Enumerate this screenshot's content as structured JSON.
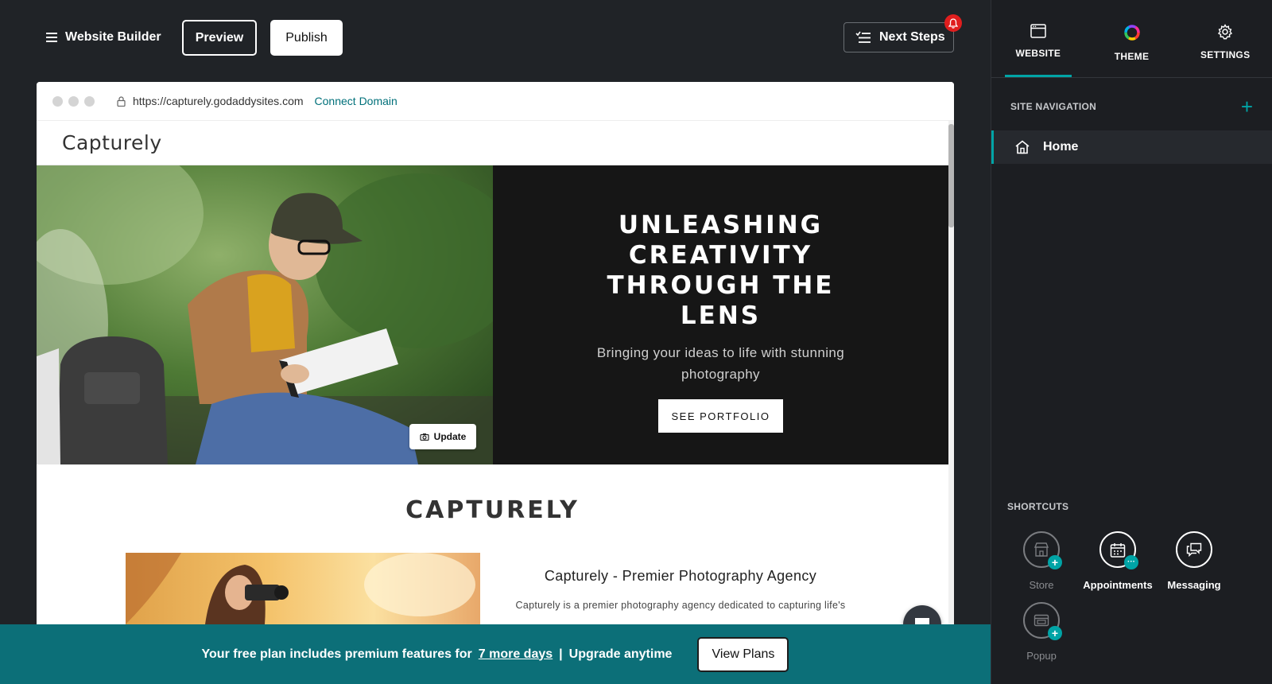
{
  "app": {
    "title": "Website Builder",
    "preview_label": "Preview",
    "publish_label": "Publish",
    "next_steps_label": "Next Steps"
  },
  "browser": {
    "url": "https://capturely.godaddysites.com",
    "connect_domain_label": "Connect Domain"
  },
  "site": {
    "logo": "Capturely",
    "hero": {
      "title": "UNLEASHING CREATIVITY THROUGH THE LENS",
      "subtitle": "Bringing your ideas to life with stunning photography",
      "cta_label": "SEE PORTFOLIO",
      "update_label": "Update"
    },
    "section_title": "CAPTURELY",
    "about": {
      "heading": "Capturely - Premier Photography Agency",
      "body": "Capturely is a premier photography agency dedicated to capturing life's"
    }
  },
  "banner": {
    "text_before": "Your free plan includes premium features for",
    "link_text": "7 more days",
    "separator": "|",
    "text_after": "Upgrade anytime",
    "button_label": "View Plans"
  },
  "panel": {
    "tabs": [
      {
        "label": "WEBSITE",
        "icon": "browser-window-icon",
        "active": true
      },
      {
        "label": "THEME",
        "icon": "color-wheel-icon",
        "active": false
      },
      {
        "label": "SETTINGS",
        "icon": "gear-icon",
        "active": false
      }
    ],
    "site_navigation_label": "SITE NAVIGATION",
    "nav_items": [
      {
        "label": "Home",
        "icon": "home-icon"
      }
    ],
    "shortcuts_label": "SHORTCUTS",
    "shortcuts": [
      {
        "label": "Store",
        "icon": "store-icon",
        "badge": "+",
        "enabled": false
      },
      {
        "label": "Appointments",
        "icon": "calendar-icon",
        "badge": "···",
        "enabled": true
      },
      {
        "label": "Messaging",
        "icon": "messaging-icon",
        "badge": "",
        "enabled": true
      },
      {
        "label": "Popup",
        "icon": "popup-icon",
        "badge": "+",
        "enabled": false
      }
    ]
  },
  "colors": {
    "accent": "#00a4a6",
    "banner": "#0c6f78",
    "notification": "#e01e1e",
    "background": "#202327"
  }
}
